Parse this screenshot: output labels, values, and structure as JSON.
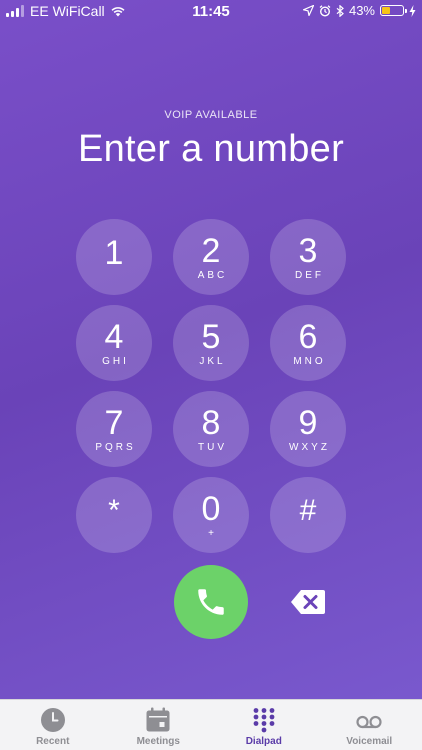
{
  "status_bar": {
    "carrier": "EE WiFiCall",
    "time": "11:45",
    "battery": "43%",
    "battery_level": 0.43
  },
  "header": {
    "voip": "VOIP AVAILABLE",
    "prompt": "Enter a number"
  },
  "keypad": [
    {
      "digit": "1",
      "letters": ""
    },
    {
      "digit": "2",
      "letters": "ABC"
    },
    {
      "digit": "3",
      "letters": "DEF"
    },
    {
      "digit": "4",
      "letters": "GHI"
    },
    {
      "digit": "5",
      "letters": "JKL"
    },
    {
      "digit": "6",
      "letters": "MNO"
    },
    {
      "digit": "7",
      "letters": "PQRS"
    },
    {
      "digit": "8",
      "letters": "TUV"
    },
    {
      "digit": "9",
      "letters": "WXYZ"
    },
    {
      "digit": "*",
      "letters": ""
    },
    {
      "digit": "0",
      "letters": "+"
    },
    {
      "digit": "#",
      "letters": ""
    }
  ],
  "actions": {
    "call_icon": "phone-icon",
    "delete_icon": "backspace-icon"
  },
  "tabs": [
    {
      "label": "Recent",
      "icon": "clock-icon",
      "active": false
    },
    {
      "label": "Meetings",
      "icon": "calendar-icon",
      "active": false
    },
    {
      "label": "Dialpad",
      "icon": "dialpad-icon",
      "active": true
    },
    {
      "label": "Voicemail",
      "icon": "voicemail-icon",
      "active": false
    }
  ],
  "colors": {
    "background": "#7148c0",
    "call_button": "#6cd269",
    "active_tab": "#5a3ba8",
    "battery": "#f5c518"
  }
}
